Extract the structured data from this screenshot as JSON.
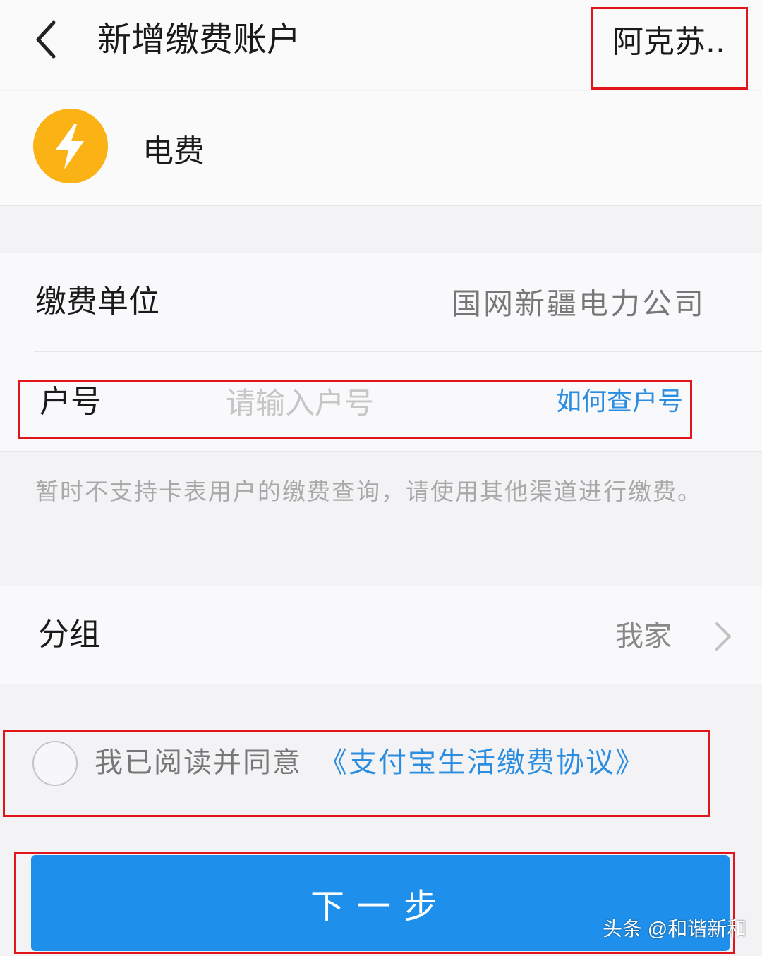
{
  "header": {
    "title": "新增缴费账户",
    "city": "阿克苏.."
  },
  "service": {
    "name": "电费",
    "icon": "lightning-icon",
    "icon_color": "#fbb215"
  },
  "form": {
    "unit_label": "缴费单位",
    "unit_value": "国网新疆电力公司",
    "account_label": "户号",
    "account_value": "",
    "account_placeholder": "请输入户号",
    "how_link": "如何查户号"
  },
  "notice": "暂时不支持卡表用户的缴费查询，请使用其他渠道进行缴费。",
  "group": {
    "label": "分组",
    "value": "我家"
  },
  "agreement": {
    "checked": false,
    "text": "我已阅读并同意",
    "link": "《支付宝生活缴费协议》"
  },
  "next_button": "下一步",
  "watermark": "头条 @和谐新和",
  "colors": {
    "accent": "#1e90ec",
    "link": "#2a8de0",
    "highlight_box": "#e0161b"
  }
}
